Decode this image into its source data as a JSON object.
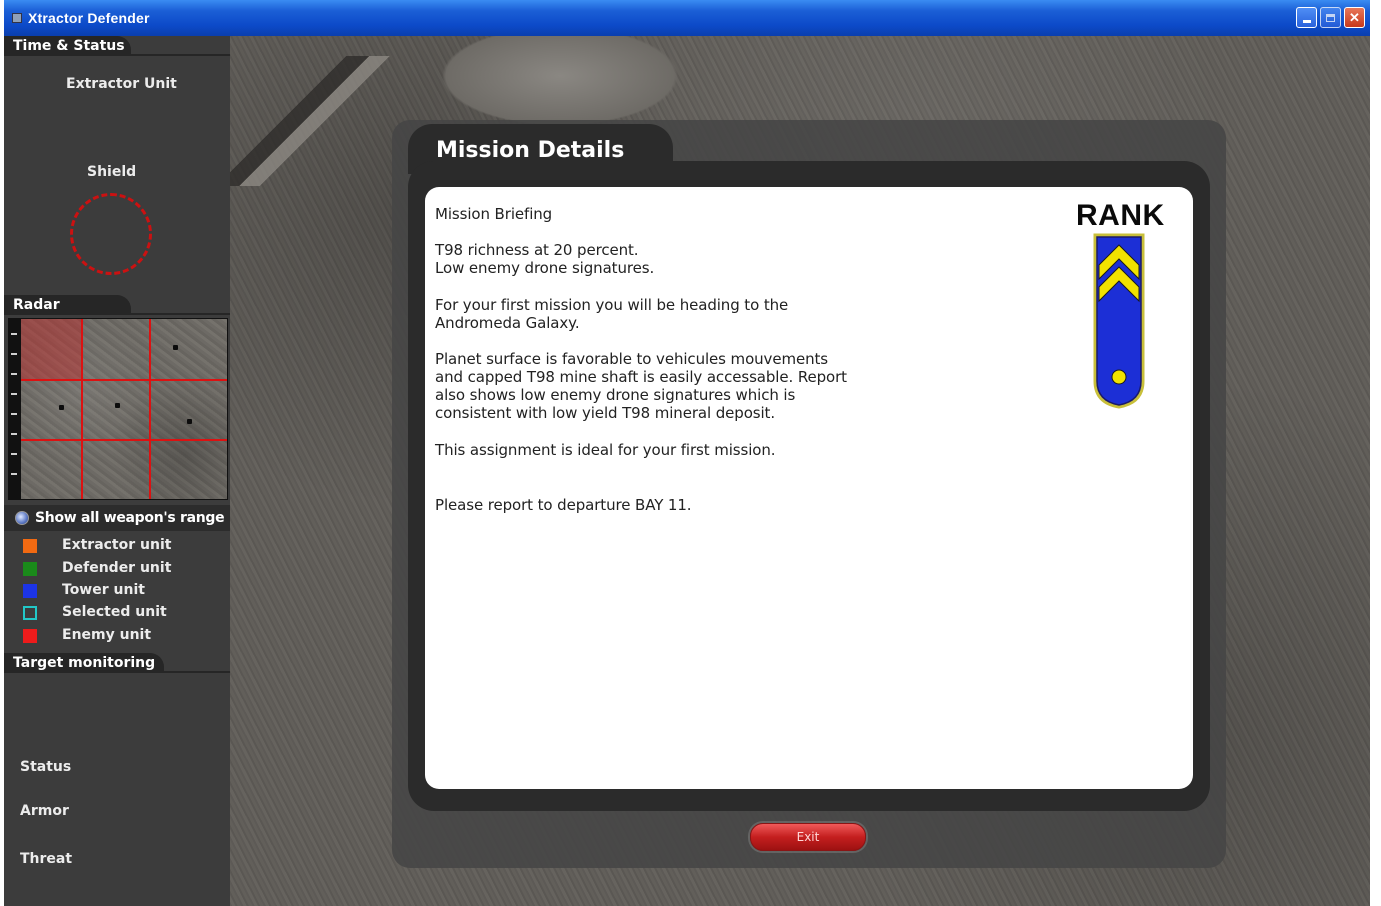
{
  "window": {
    "title": "Xtractor Defender",
    "controls": {
      "minimize_icon": "minimize-icon",
      "maximize_icon": "maximize-icon",
      "close_icon": "close-icon",
      "close_glyph": "✕"
    }
  },
  "sidebar": {
    "time_status_heading": "Time & Status",
    "extractor_unit_label": "Extractor Unit",
    "shield_label": "Shield",
    "radar_heading": "Radar",
    "weapon_range_toggle": "Show all weapon's range",
    "legend": [
      {
        "label": "Extractor unit",
        "color": "#f26a12",
        "style": "filled"
      },
      {
        "label": "Defender unit",
        "color": "#1a8a1a",
        "style": "filled"
      },
      {
        "label": "Tower unit",
        "color": "#1c34e6",
        "style": "filled"
      },
      {
        "label": "Selected unit",
        "color": "#22c8c8",
        "style": "outline"
      },
      {
        "label": "Enemy unit",
        "color": "#ee1b1b",
        "style": "filled"
      }
    ],
    "target_monitoring_heading": "Target monitoring",
    "status_label": "Status",
    "armor_label": "Armor",
    "threat_label": "Threat"
  },
  "mission": {
    "title": "Mission Details",
    "briefing": {
      "heading": "Mission Briefing",
      "paragraph_1": "T98 richness at 20 percent.\nLow enemy drone signatures.",
      "paragraph_2": "For your first mission you will be heading to the\nAndromeda Galaxy.",
      "paragraph_3": "Planet surface is favorable to vehicules mouvements\nand capped T98 mine shaft is easily accessable. Report\nalso shows low enemy drone signatures which is\nconsistent with low yield T98 mineral deposit.",
      "paragraph_4": "This assignment is ideal for your first mission.",
      "paragraph_5": "Please report to departure BAY 11."
    },
    "rank_label": "RANK",
    "rank_badge_icon": "rank-chevron-badge-icon",
    "exit_button": "Exit"
  },
  "colors": {
    "titlebar": "#0c4ac9",
    "sidebar_bg": "#3c3c3c",
    "panel_dark": "#2b2b2b",
    "shield_ring": "#cc1111",
    "radar_grid": "#dd1111",
    "rank_blue": "#1c2fd6",
    "rank_gold": "#f2e200",
    "exit_red": "#c41f1f"
  }
}
